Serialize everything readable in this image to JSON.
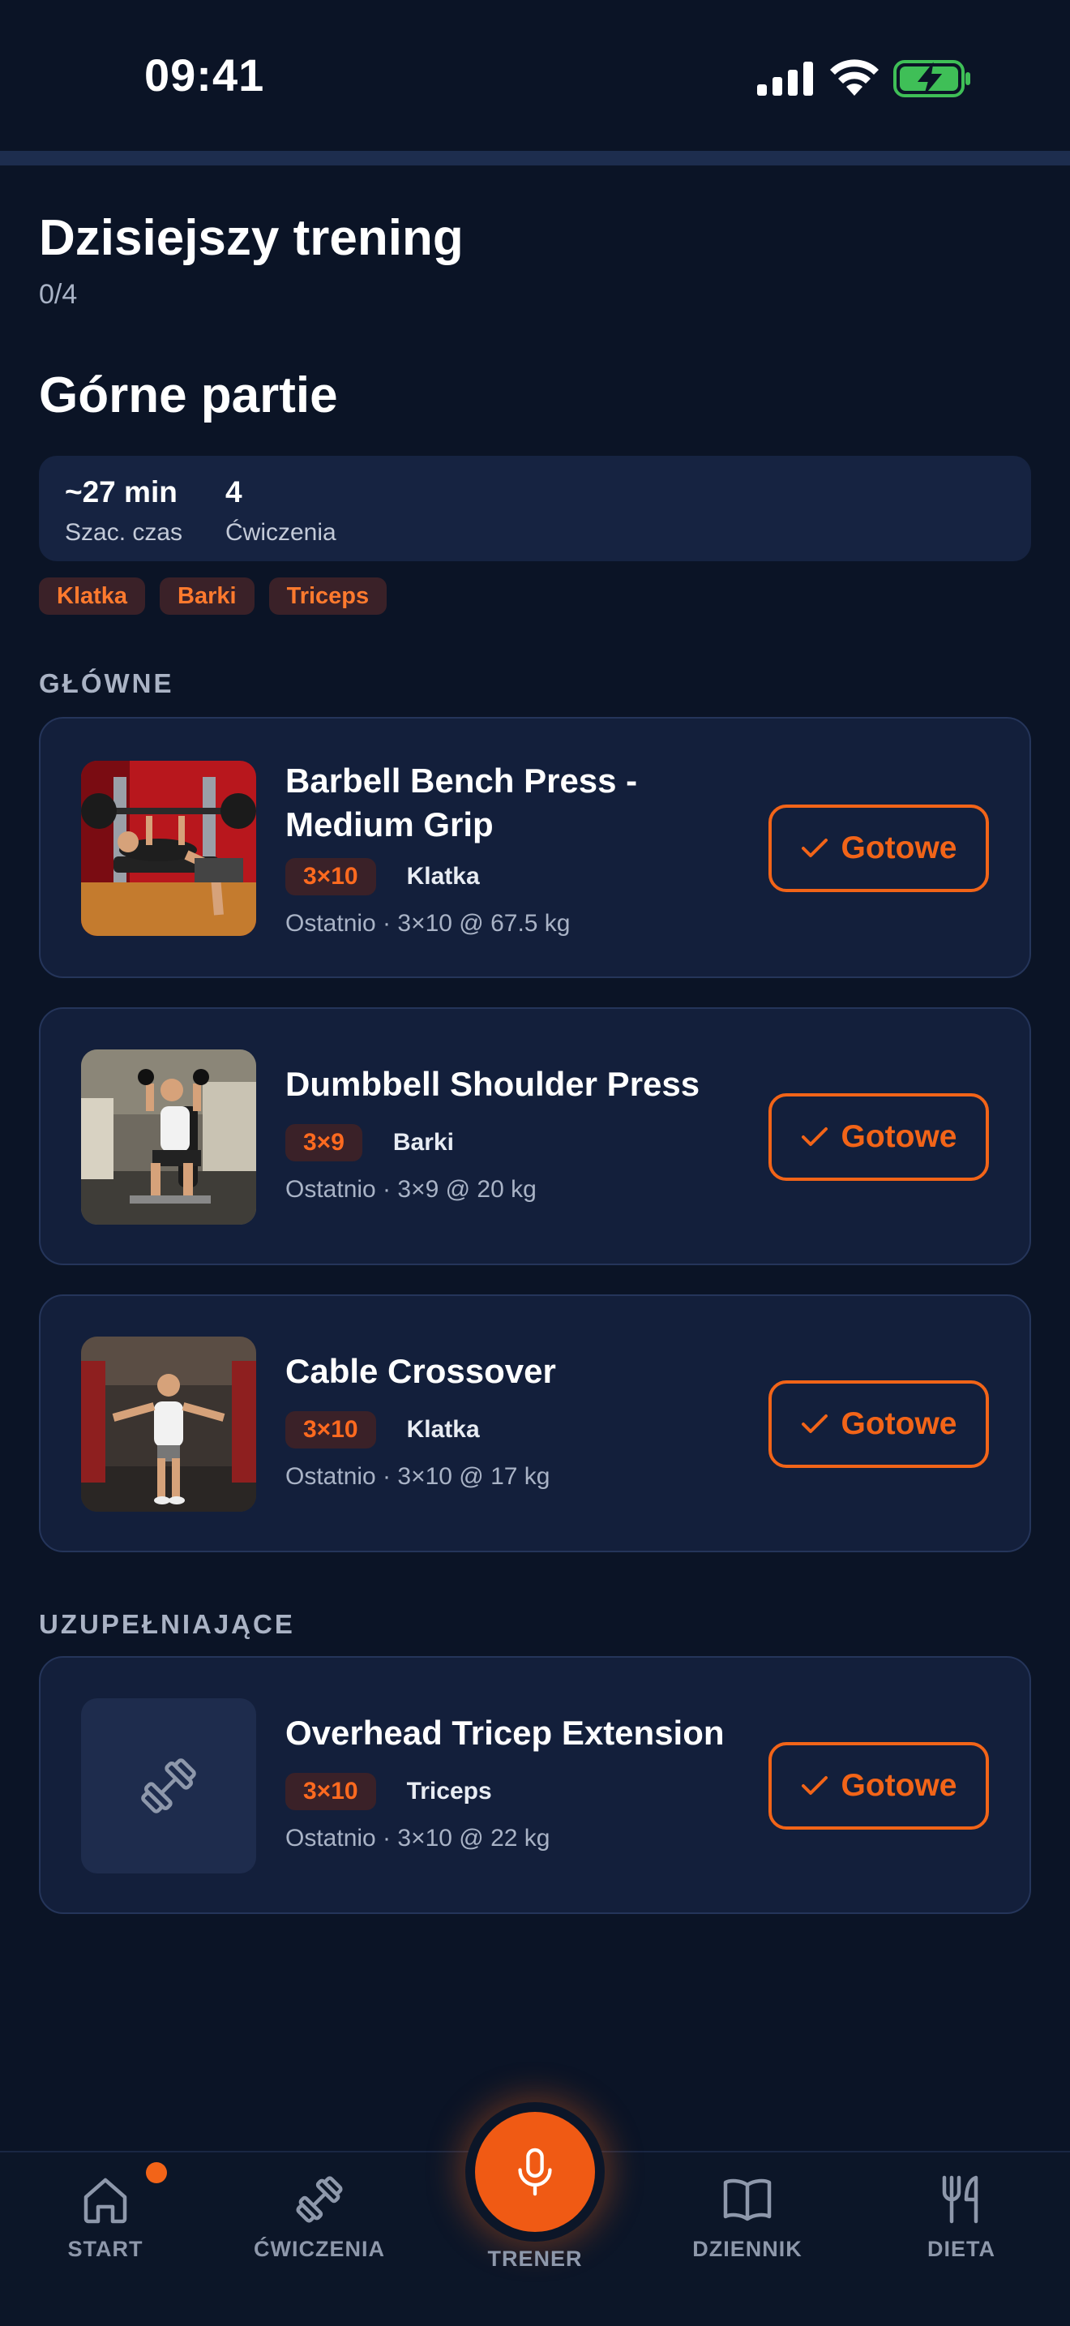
{
  "status_bar": {
    "time": "09:41"
  },
  "progress": {
    "completed": 0,
    "total": 4
  },
  "header": {
    "title": "Dzisiejszy trening",
    "progress_text": "0/4"
  },
  "workout": {
    "name": "Górne partie",
    "stats": [
      {
        "value": "~27 min",
        "label": "Szac. czas"
      },
      {
        "value": "4",
        "label": "Ćwiczenia"
      }
    ],
    "tags": [
      "Klatka",
      "Barki",
      "Triceps"
    ]
  },
  "sections": [
    {
      "label": "GŁÓWNE",
      "exercises": [
        {
          "name": "Barbell Bench Press - Medium Grip",
          "sets": "3×10",
          "muscle": "Klatka",
          "last": "Ostatnio · 3×10 @ 67.5 kg",
          "button": "Gotowe"
        },
        {
          "name": "Dumbbell Shoulder Press",
          "sets": "3×9",
          "muscle": "Barki",
          "last": "Ostatnio · 3×9 @ 20 kg",
          "button": "Gotowe"
        },
        {
          "name": "Cable Crossover",
          "sets": "3×10",
          "muscle": "Klatka",
          "last": "Ostatnio · 3×10 @ 17 kg",
          "button": "Gotowe"
        }
      ]
    },
    {
      "label": "UZUPEŁNIAJĄCE",
      "exercises": [
        {
          "name": "Overhead Tricep Extension",
          "sets": "3×10",
          "muscle": "Triceps",
          "last": "Ostatnio · 3×10 @ 22 kg",
          "button": "Gotowe"
        }
      ]
    }
  ],
  "nav": {
    "items": [
      {
        "label": "START",
        "icon": "home-icon"
      },
      {
        "label": "ĆWICZENIA",
        "icon": "dumbbell-icon"
      },
      {
        "label": "TRENER",
        "icon": "microphone-icon"
      },
      {
        "label": "DZIENNIK",
        "icon": "book-icon"
      },
      {
        "label": "DIETA",
        "icon": "fork-knife-icon"
      }
    ]
  },
  "colors": {
    "accent": "#f26418",
    "background": "#0b1426",
    "card": "#131f3b"
  }
}
